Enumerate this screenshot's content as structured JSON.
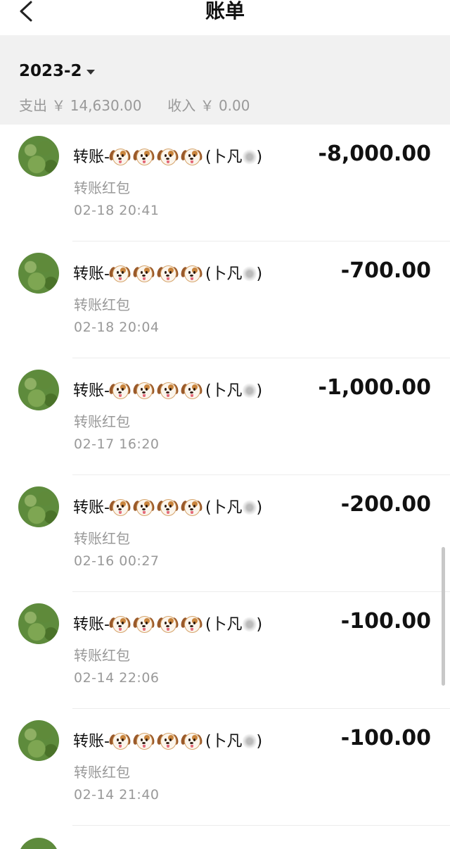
{
  "header": {
    "title": "账单",
    "back_icon": "chevron-left-icon"
  },
  "summary": {
    "month": "2023-2",
    "expense_label": "支出 ￥",
    "expense_value": "14,630.00",
    "income_label": "收入 ￥",
    "income_value": "0.00"
  },
  "transactions": [
    {
      "name_prefix": "转账-",
      "name_open": "(卜凡",
      "name_close": ")",
      "subtitle": "转账红包",
      "time": "02-18  20:41",
      "amount": "-8,000.00"
    },
    {
      "name_prefix": "转账-",
      "name_open": "(卜凡",
      "name_close": ")",
      "subtitle": "转账红包",
      "time": "02-18  20:04",
      "amount": "-700.00"
    },
    {
      "name_prefix": "转账-",
      "name_open": "(卜凡",
      "name_close": ")",
      "subtitle": "转账红包",
      "time": "02-17  16:20",
      "amount": "-1,000.00"
    },
    {
      "name_prefix": "转账-",
      "name_open": "(卜凡",
      "name_close": ")",
      "subtitle": "转账红包",
      "time": "02-16  00:27",
      "amount": "-200.00"
    },
    {
      "name_prefix": "转账-",
      "name_open": "(卜凡",
      "name_close": ")",
      "subtitle": "转账红包",
      "time": "02-14  22:06",
      "amount": "-100.00"
    },
    {
      "name_prefix": "转账-",
      "name_open": "(卜凡",
      "name_close": ")",
      "subtitle": "转账红包",
      "time": "02-14  21:40",
      "amount": "-100.00"
    }
  ]
}
